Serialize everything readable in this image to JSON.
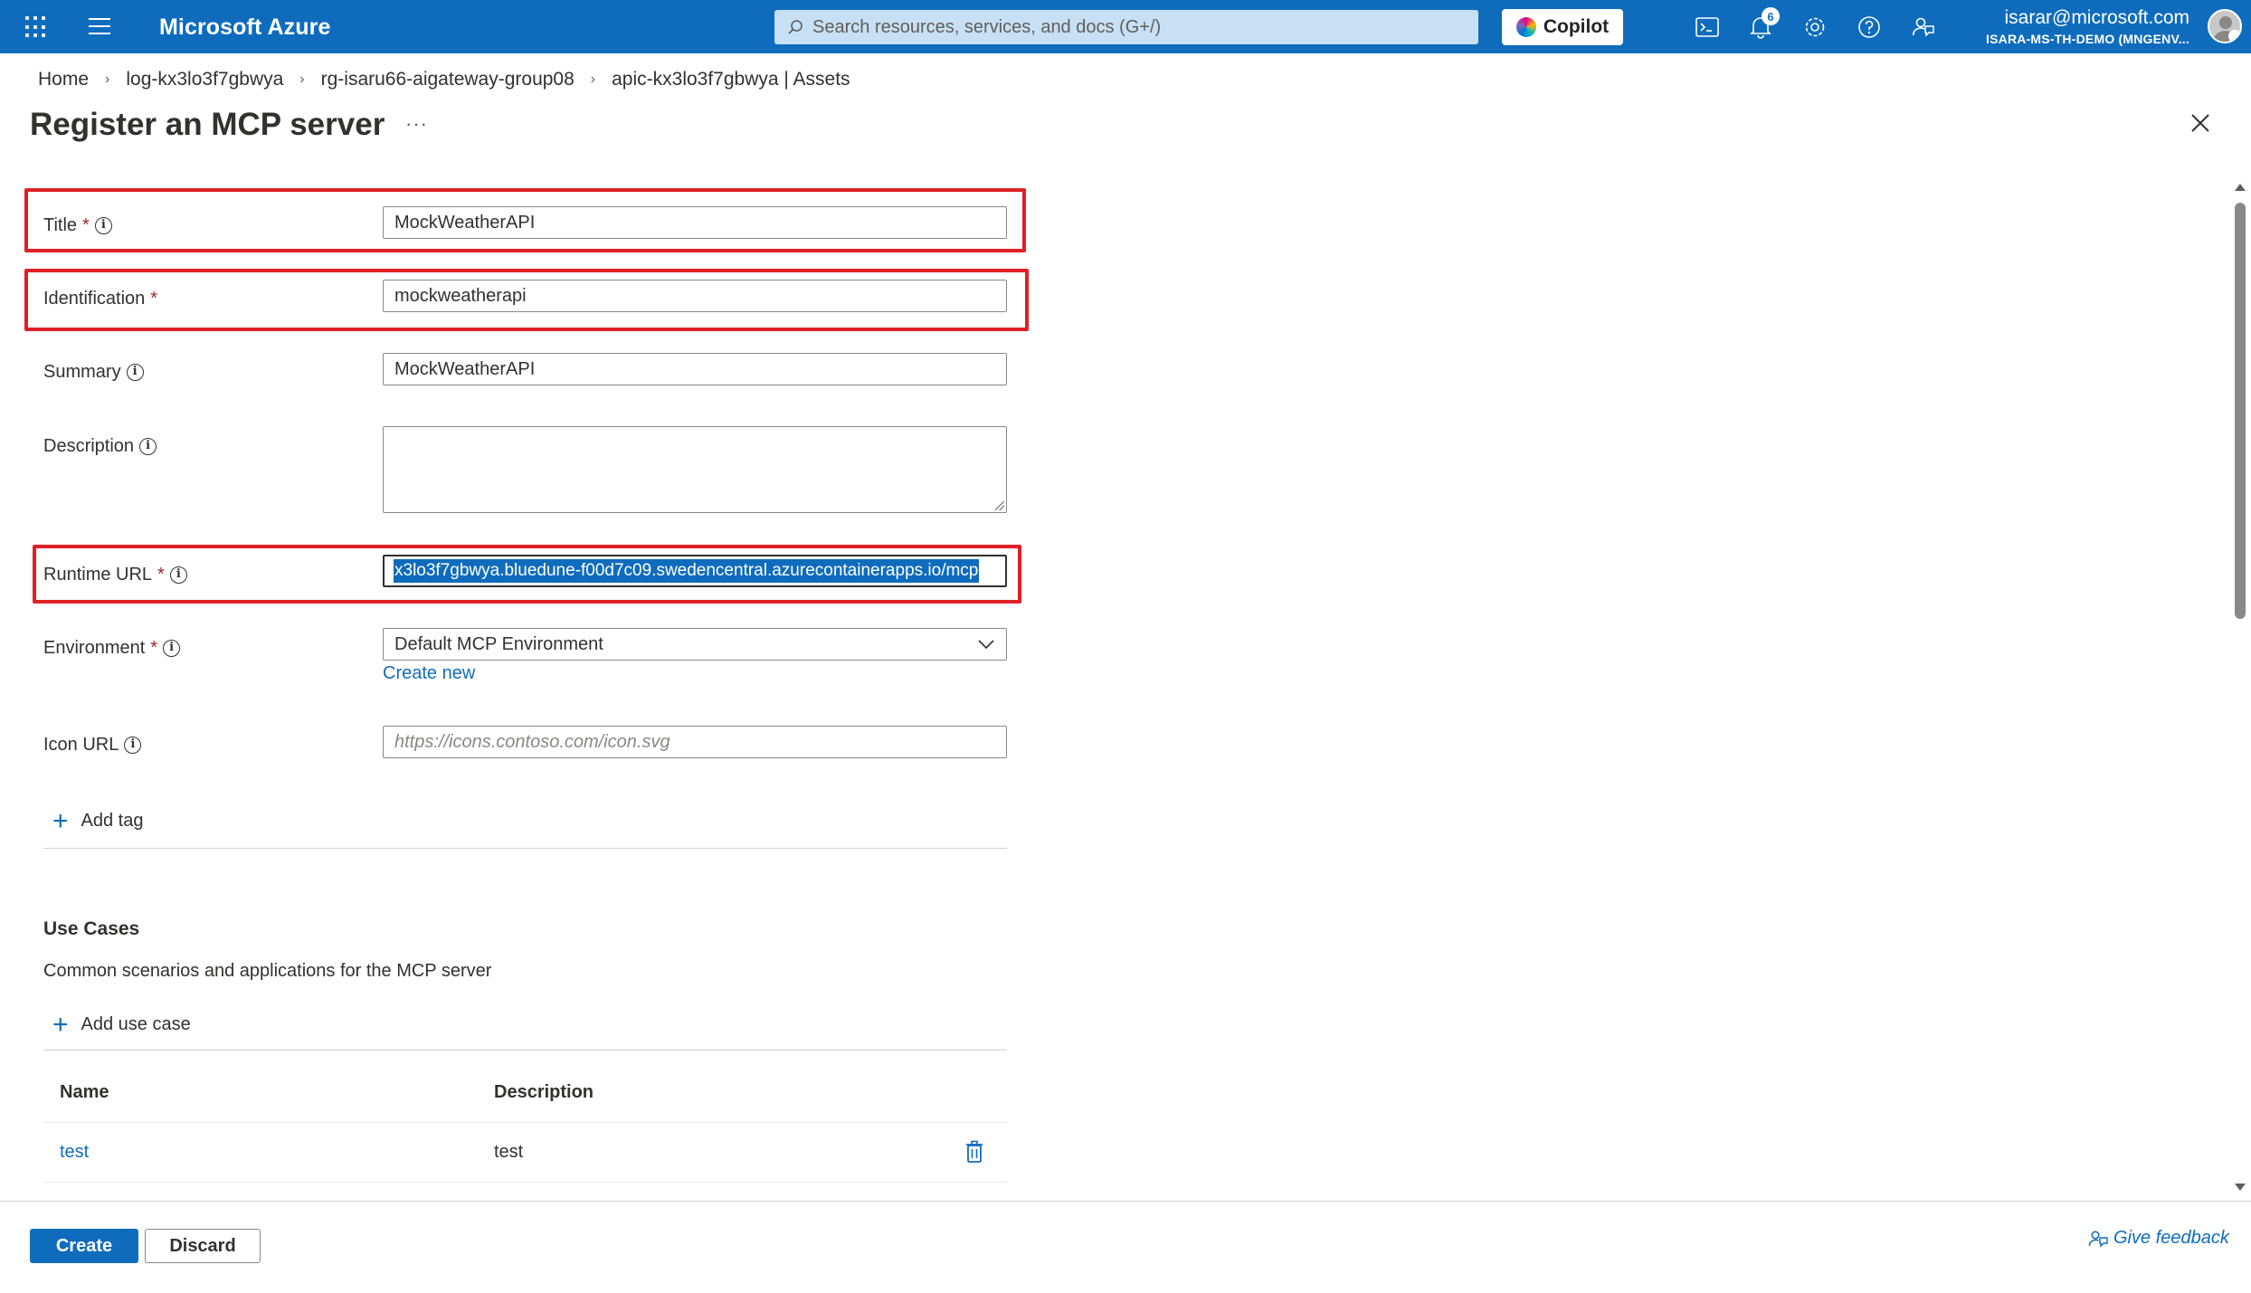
{
  "topbar": {
    "brand": "Microsoft Azure",
    "search_placeholder": "Search resources, services, and docs (G+/)",
    "copilot_label": "Copilot",
    "notification_count": "6",
    "account_email": "isarar@microsoft.com",
    "account_tenant": "ISARA-MS-TH-DEMO (MNGENV...",
    "bar_color": "#0f6cbd"
  },
  "breadcrumb": [
    "Home",
    "log-kx3lo3f7gbwya",
    "rg-isaru66-aigateway-group08",
    "apic-kx3lo3f7gbwya | Assets"
  ],
  "page": {
    "title": "Register an MCP server",
    "more": "···"
  },
  "form": {
    "title": {
      "label": "Title",
      "required": "*",
      "value": "MockWeatherAPI"
    },
    "identification": {
      "label": "Identification",
      "required": "*",
      "value": "mockweatherapi"
    },
    "summary": {
      "label": "Summary",
      "value": "MockWeatherAPI"
    },
    "description": {
      "label": "Description",
      "value": ""
    },
    "runtime_url": {
      "label": "Runtime URL",
      "required": "*",
      "value": "x3lo3f7gbwya.bluedune-f00d7c09.swedencentral.azurecontainerapps.io/mcp"
    },
    "environment": {
      "label": "Environment",
      "required": "*",
      "value": "Default MCP Environment",
      "create_new": "Create new"
    },
    "icon_url": {
      "label": "Icon URL",
      "placeholder": "https://icons.contoso.com/icon.svg"
    },
    "add_tag": "Add tag"
  },
  "use_cases": {
    "title": "Use Cases",
    "description": "Common scenarios and applications for the MCP server",
    "add_label": "Add use case",
    "columns": [
      "Name",
      "Description"
    ],
    "rows": [
      {
        "name": "test",
        "description": "test"
      }
    ]
  },
  "footer": {
    "create": "Create",
    "discard": "Discard",
    "feedback": "Give feedback"
  },
  "colors": {
    "accent": "#0f6cbd",
    "highlight_box": "#e01f26",
    "required": "#a4262c"
  }
}
